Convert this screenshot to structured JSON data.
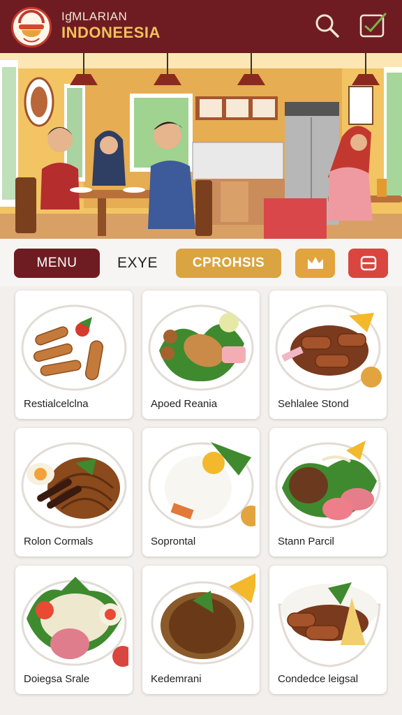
{
  "header": {
    "brand_top": "IɠMLARIAN",
    "brand_main": "INDONEESIA",
    "logo_name": "restaurant-logo",
    "logo_text": "DESSIFANTIALS OSA RLOKTS",
    "search_icon": "search-icon",
    "order_icon": "checklist-icon",
    "bg_color": "#6e1c22",
    "accent": "#f2c15a"
  },
  "filters": {
    "menu_label": "MENU",
    "exe_label": "EXYE",
    "promo_label": "CPROHSIS",
    "fav_icon": "crown-icon",
    "list_icon": "list-icon"
  },
  "dishes": [
    {
      "name": "Restialcelclna"
    },
    {
      "name": "Apoed Reania"
    },
    {
      "name": "Sehlalee Stond"
    },
    {
      "name": "Rolon Cormals"
    },
    {
      "name": "Soprontal"
    },
    {
      "name": "Stann Parcil"
    },
    {
      "name": "Doiegsa Srale"
    },
    {
      "name": "Kedemrani"
    },
    {
      "name": "Condedce leigsal"
    }
  ],
  "colors": {
    "primary": "#6e1c22",
    "gold": "#d9a441",
    "red": "#d9463f",
    "background": "#f3efec"
  }
}
